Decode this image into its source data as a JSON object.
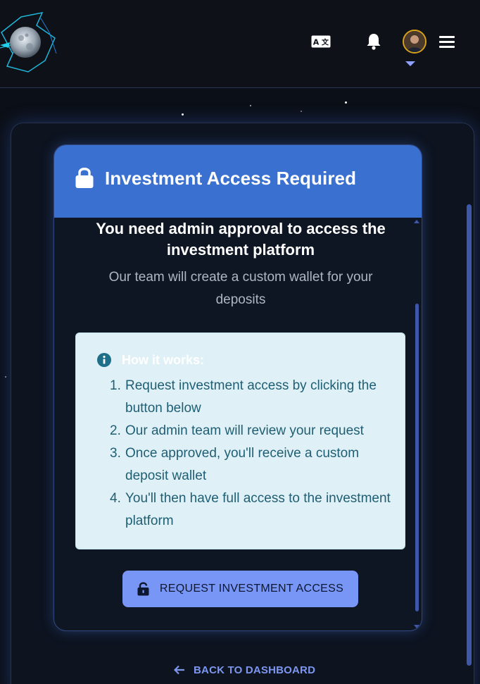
{
  "header": {
    "logo_icon": "moon-logo-icon",
    "translate_icon": "translate-icon",
    "bell_icon": "bell-icon",
    "avatar_icon": "avatar",
    "menu_icon": "hamburger-menu-icon"
  },
  "card": {
    "title": "Investment Access Required",
    "title_icon": "lock-icon",
    "headline": "You need admin approval to access the investment platform",
    "subline": "Our team will create a custom wallet for your deposits",
    "info": {
      "icon": "info-icon",
      "title": "How it works:",
      "steps": [
        {
          "num": "1.",
          "text": "Request investment access by clicking the button below"
        },
        {
          "num": "2.",
          "text": "Our admin team will review your request"
        },
        {
          "num": "3.",
          "text": "Once approved, you'll receive a custom deposit wallet"
        },
        {
          "num": "4.",
          "text": "You'll then have full access to the investment platform"
        }
      ]
    },
    "request_button": {
      "label": "REQUEST INVESTMENT ACCESS",
      "icon": "unlock-icon"
    }
  },
  "back_link": {
    "label": "BACK TO DASHBOARD",
    "icon": "arrow-left-icon"
  },
  "colors": {
    "accent": "#3a70cf",
    "button": "#7896f5",
    "info_bg": "#dff1f6",
    "info_text": "#1f5e73",
    "link": "#7d97f0",
    "background": "#0b0f17"
  }
}
